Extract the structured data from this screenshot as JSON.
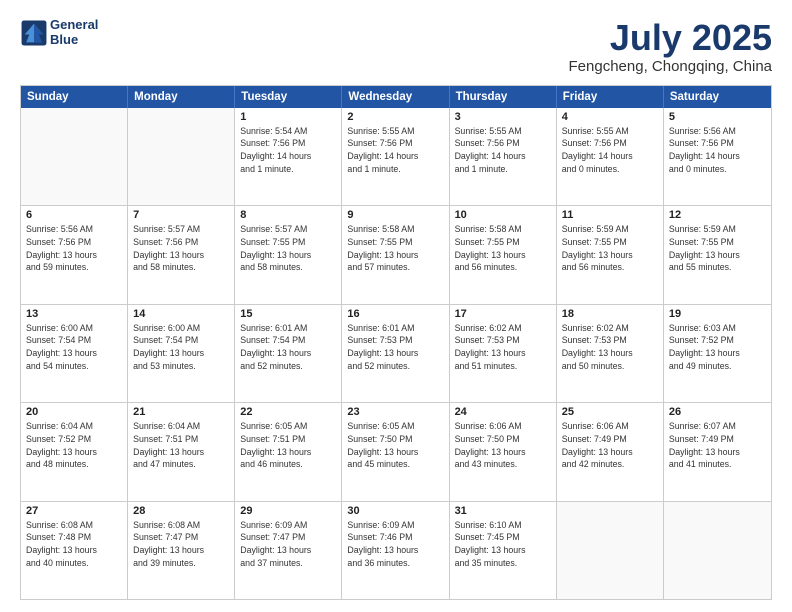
{
  "header": {
    "logo_line1": "General",
    "logo_line2": "Blue",
    "month": "July 2025",
    "location": "Fengcheng, Chongqing, China"
  },
  "days_of_week": [
    "Sunday",
    "Monday",
    "Tuesday",
    "Wednesday",
    "Thursday",
    "Friday",
    "Saturday"
  ],
  "weeks": [
    [
      {
        "day": "",
        "info": ""
      },
      {
        "day": "",
        "info": ""
      },
      {
        "day": "1",
        "info": "Sunrise: 5:54 AM\nSunset: 7:56 PM\nDaylight: 14 hours\nand 1 minute."
      },
      {
        "day": "2",
        "info": "Sunrise: 5:55 AM\nSunset: 7:56 PM\nDaylight: 14 hours\nand 1 minute."
      },
      {
        "day": "3",
        "info": "Sunrise: 5:55 AM\nSunset: 7:56 PM\nDaylight: 14 hours\nand 1 minute."
      },
      {
        "day": "4",
        "info": "Sunrise: 5:55 AM\nSunset: 7:56 PM\nDaylight: 14 hours\nand 0 minutes."
      },
      {
        "day": "5",
        "info": "Sunrise: 5:56 AM\nSunset: 7:56 PM\nDaylight: 14 hours\nand 0 minutes."
      }
    ],
    [
      {
        "day": "6",
        "info": "Sunrise: 5:56 AM\nSunset: 7:56 PM\nDaylight: 13 hours\nand 59 minutes."
      },
      {
        "day": "7",
        "info": "Sunrise: 5:57 AM\nSunset: 7:56 PM\nDaylight: 13 hours\nand 58 minutes."
      },
      {
        "day": "8",
        "info": "Sunrise: 5:57 AM\nSunset: 7:55 PM\nDaylight: 13 hours\nand 58 minutes."
      },
      {
        "day": "9",
        "info": "Sunrise: 5:58 AM\nSunset: 7:55 PM\nDaylight: 13 hours\nand 57 minutes."
      },
      {
        "day": "10",
        "info": "Sunrise: 5:58 AM\nSunset: 7:55 PM\nDaylight: 13 hours\nand 56 minutes."
      },
      {
        "day": "11",
        "info": "Sunrise: 5:59 AM\nSunset: 7:55 PM\nDaylight: 13 hours\nand 56 minutes."
      },
      {
        "day": "12",
        "info": "Sunrise: 5:59 AM\nSunset: 7:55 PM\nDaylight: 13 hours\nand 55 minutes."
      }
    ],
    [
      {
        "day": "13",
        "info": "Sunrise: 6:00 AM\nSunset: 7:54 PM\nDaylight: 13 hours\nand 54 minutes."
      },
      {
        "day": "14",
        "info": "Sunrise: 6:00 AM\nSunset: 7:54 PM\nDaylight: 13 hours\nand 53 minutes."
      },
      {
        "day": "15",
        "info": "Sunrise: 6:01 AM\nSunset: 7:54 PM\nDaylight: 13 hours\nand 52 minutes."
      },
      {
        "day": "16",
        "info": "Sunrise: 6:01 AM\nSunset: 7:53 PM\nDaylight: 13 hours\nand 52 minutes."
      },
      {
        "day": "17",
        "info": "Sunrise: 6:02 AM\nSunset: 7:53 PM\nDaylight: 13 hours\nand 51 minutes."
      },
      {
        "day": "18",
        "info": "Sunrise: 6:02 AM\nSunset: 7:53 PM\nDaylight: 13 hours\nand 50 minutes."
      },
      {
        "day": "19",
        "info": "Sunrise: 6:03 AM\nSunset: 7:52 PM\nDaylight: 13 hours\nand 49 minutes."
      }
    ],
    [
      {
        "day": "20",
        "info": "Sunrise: 6:04 AM\nSunset: 7:52 PM\nDaylight: 13 hours\nand 48 minutes."
      },
      {
        "day": "21",
        "info": "Sunrise: 6:04 AM\nSunset: 7:51 PM\nDaylight: 13 hours\nand 47 minutes."
      },
      {
        "day": "22",
        "info": "Sunrise: 6:05 AM\nSunset: 7:51 PM\nDaylight: 13 hours\nand 46 minutes."
      },
      {
        "day": "23",
        "info": "Sunrise: 6:05 AM\nSunset: 7:50 PM\nDaylight: 13 hours\nand 45 minutes."
      },
      {
        "day": "24",
        "info": "Sunrise: 6:06 AM\nSunset: 7:50 PM\nDaylight: 13 hours\nand 43 minutes."
      },
      {
        "day": "25",
        "info": "Sunrise: 6:06 AM\nSunset: 7:49 PM\nDaylight: 13 hours\nand 42 minutes."
      },
      {
        "day": "26",
        "info": "Sunrise: 6:07 AM\nSunset: 7:49 PM\nDaylight: 13 hours\nand 41 minutes."
      }
    ],
    [
      {
        "day": "27",
        "info": "Sunrise: 6:08 AM\nSunset: 7:48 PM\nDaylight: 13 hours\nand 40 minutes."
      },
      {
        "day": "28",
        "info": "Sunrise: 6:08 AM\nSunset: 7:47 PM\nDaylight: 13 hours\nand 39 minutes."
      },
      {
        "day": "29",
        "info": "Sunrise: 6:09 AM\nSunset: 7:47 PM\nDaylight: 13 hours\nand 37 minutes."
      },
      {
        "day": "30",
        "info": "Sunrise: 6:09 AM\nSunset: 7:46 PM\nDaylight: 13 hours\nand 36 minutes."
      },
      {
        "day": "31",
        "info": "Sunrise: 6:10 AM\nSunset: 7:45 PM\nDaylight: 13 hours\nand 35 minutes."
      },
      {
        "day": "",
        "info": ""
      },
      {
        "day": "",
        "info": ""
      }
    ]
  ]
}
